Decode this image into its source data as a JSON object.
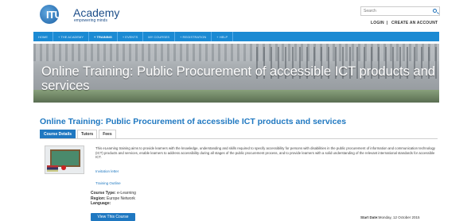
{
  "header": {
    "logo_acronym": "ITU",
    "logo_title": "Academy",
    "logo_tagline": "empowering minds",
    "search_placeholder": "Search",
    "login_label": "LOGIN",
    "separator": "|",
    "create_account_label": "CREATE AN ACCOUNT"
  },
  "nav": {
    "items": [
      {
        "label": "HOME"
      },
      {
        "label": "+ THE ACADEMY"
      },
      {
        "label": "+ TRAINING"
      },
      {
        "label": "+ EVENTS"
      },
      {
        "label": "MY COURSES"
      },
      {
        "label": "+ REGISTRATION"
      },
      {
        "label": "+ HELP"
      }
    ],
    "active_index": 2
  },
  "banner": {
    "title": "Online Training: Public Procurement of accessible ICT products and services"
  },
  "course": {
    "title": "Online Training: Public Procurement of accessible ICT products and services",
    "tabs": [
      {
        "label": "Course Details"
      },
      {
        "label": "Tutors"
      },
      {
        "label": "Fees"
      }
    ],
    "active_tab": 0,
    "description": "This eLearning training aims to provide learners with the knowledge, understanding and skills required to specify accessibility for persons with disabilities in the public procurement of information and communication technology (ICT) products and services, enable learners to address accessibility during all stages of the public procurement process, and to provide learners with a solid understanding of the relevant international standards for accessible ICT.",
    "invitation_letter": "Invitation letter",
    "training_outline": "Training Outline",
    "course_type_label": "Course Type:",
    "course_type_value": "e-Learning",
    "region_label": "Region:",
    "region_value": "Europe Network",
    "language_label": "Language:",
    "language_value": "",
    "view_button": "View This Course",
    "start_date_label": "Start Date:",
    "start_date_value": "Monday, 12 October 2015"
  },
  "colors": {
    "nav_blue": "#1b8ad3",
    "title_blue": "#1f78c1",
    "logo_blue": "#1d4e89"
  }
}
